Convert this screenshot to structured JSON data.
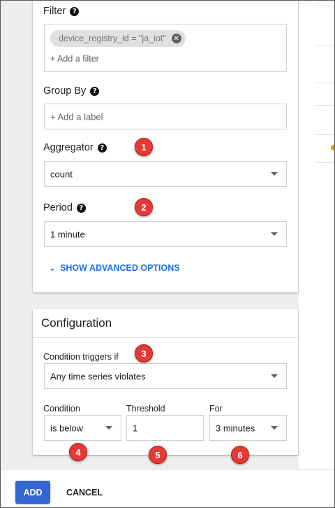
{
  "metric": {
    "filter": {
      "label": "Filter",
      "help_icon": "help-circle-icon",
      "chip": "device_registry_id = \"ja_iot\"",
      "chip_remove_icon": "close-circle-icon",
      "add_label": "+ Add a filter"
    },
    "group_by": {
      "label": "Group By",
      "placeholder": "+ Add a label"
    },
    "aggregator": {
      "label": "Aggregator",
      "value": "count"
    },
    "period": {
      "label": "Period",
      "value": "1 minute"
    },
    "advanced": {
      "label": "SHOW ADVANCED OPTIONS",
      "icon": "chevron-down-icon"
    }
  },
  "configuration": {
    "title": "Configuration",
    "trigger": {
      "label": "Condition triggers if",
      "value": "Any time series violates"
    },
    "condition": {
      "label": "Condition",
      "value": "is below"
    },
    "threshold": {
      "label": "Threshold",
      "value": "1"
    },
    "for": {
      "label": "For",
      "value": "3 minutes"
    }
  },
  "annotations": [
    "1",
    "2",
    "3",
    "4",
    "5",
    "6"
  ],
  "footer": {
    "add_label": "ADD",
    "cancel_label": "CANCEL"
  },
  "colors": {
    "primary": "#3367d6",
    "link": "#1a73e8",
    "badge": "#e53935",
    "status_dot": "#f29900"
  }
}
